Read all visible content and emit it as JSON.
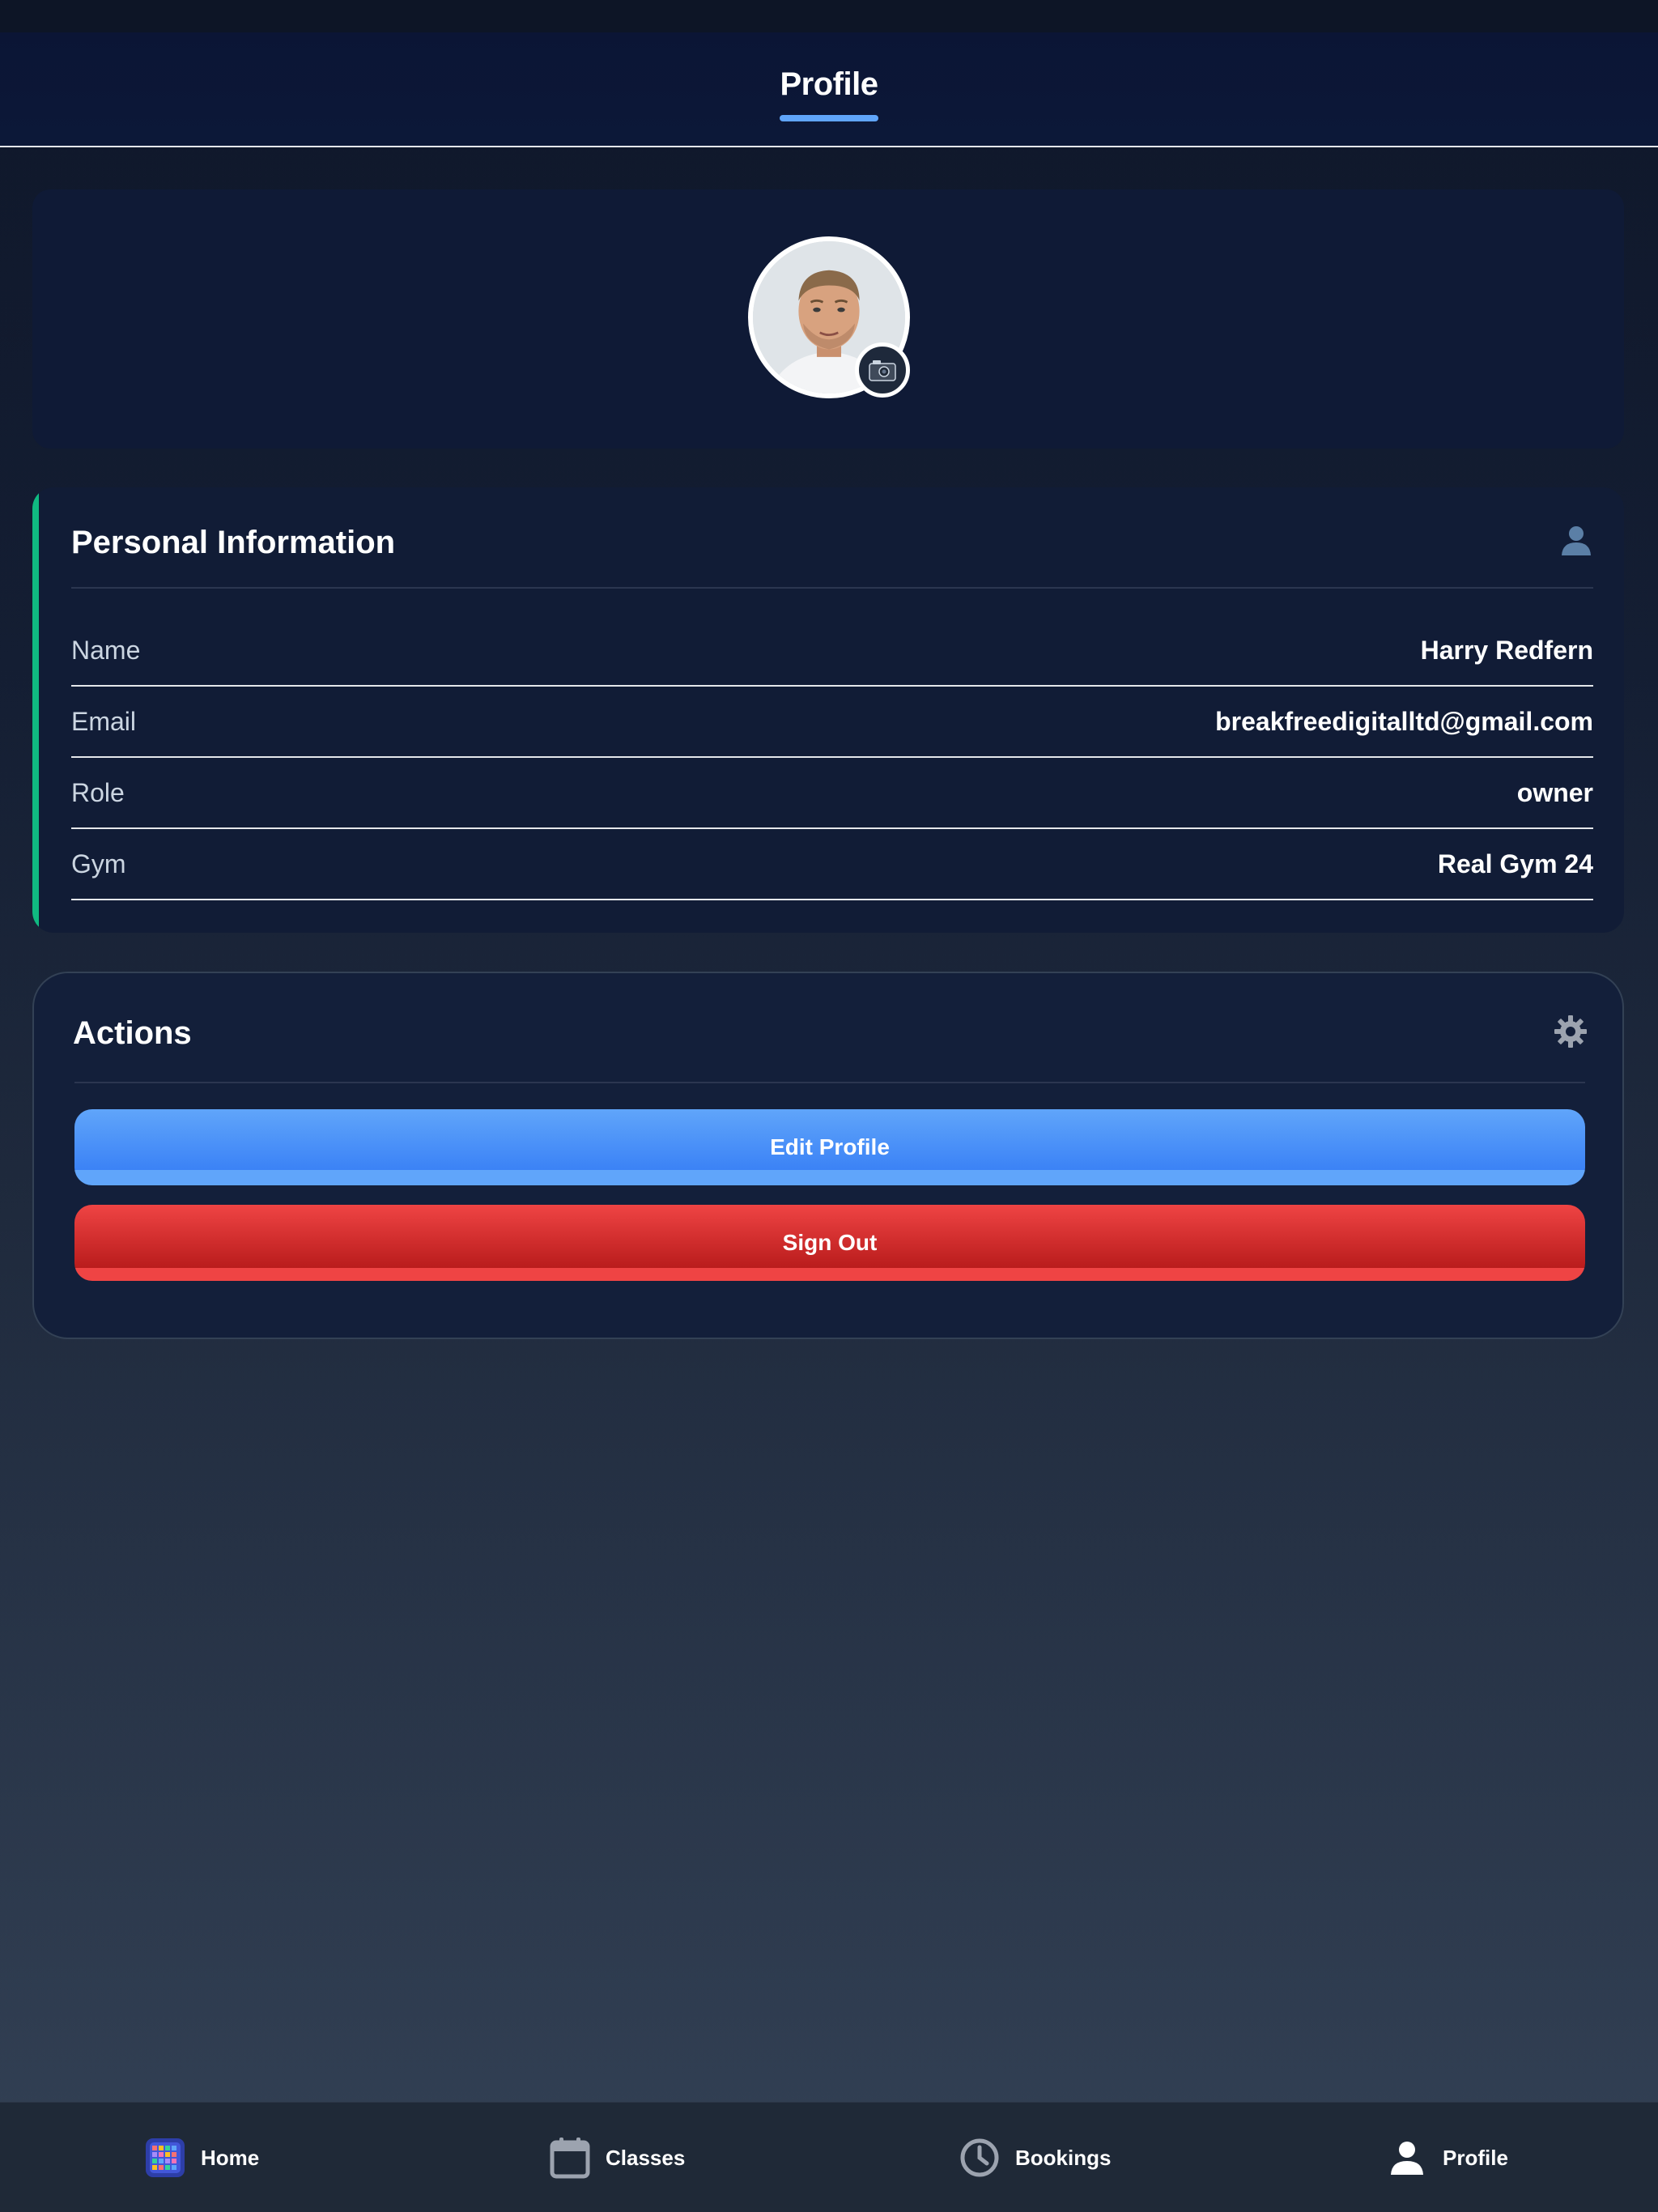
{
  "header": {
    "title": "Profile"
  },
  "profile": {
    "avatar_icon": "user-photo",
    "camera_icon": "camera-icon"
  },
  "personal_info": {
    "title": "Personal Information",
    "icon": "user-icon",
    "rows": [
      {
        "label": "Name",
        "value": "Harry Redfern"
      },
      {
        "label": "Email",
        "value": "breakfreedigitalltd@gmail.com"
      },
      {
        "label": "Role",
        "value": "owner"
      },
      {
        "label": "Gym",
        "value": "Real Gym 24"
      }
    ]
  },
  "actions": {
    "title": "Actions",
    "icon": "gear-icon",
    "edit_label": "Edit Profile",
    "signout_label": "Sign Out"
  },
  "nav": {
    "items": [
      {
        "label": "Home",
        "icon": "calendar-grid-icon"
      },
      {
        "label": "Classes",
        "icon": "calendar-icon"
      },
      {
        "label": "Bookings",
        "icon": "clock-icon"
      },
      {
        "label": "Profile",
        "icon": "person-icon"
      }
    ]
  },
  "colors": {
    "accent_blue": "#60a5fa",
    "accent_green": "#10b981",
    "danger_red": "#ef4444"
  }
}
